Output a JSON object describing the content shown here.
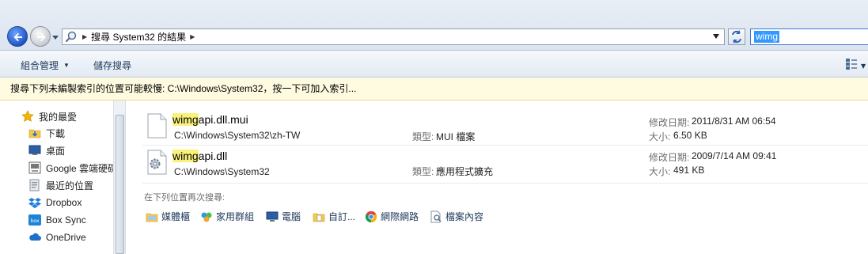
{
  "address_bar": {
    "breadcrumb": "搜尋 System32 的結果",
    "search_value": "wimg"
  },
  "toolbar": {
    "organize_label": "組合管理",
    "save_search_label": "儲存搜尋"
  },
  "info_bar": {
    "message": "搜尋下列未編製索引的位置可能較慢: C:\\Windows\\System32，按一下可加入索引..."
  },
  "nav_pane": {
    "favorites_label": "我的最愛",
    "items": [
      {
        "label": "下載",
        "icon": "download-folder-icon"
      },
      {
        "label": "桌面",
        "icon": "desktop-icon"
      },
      {
        "label": "Google 雲端硬碟",
        "icon": "google-drive-icon"
      },
      {
        "label": "最近的位置",
        "icon": "recent-places-icon"
      },
      {
        "label": "Dropbox",
        "icon": "dropbox-icon"
      },
      {
        "label": "Box Sync",
        "icon": "box-sync-icon"
      },
      {
        "label": "OneDrive",
        "icon": "onedrive-icon"
      }
    ]
  },
  "results": [
    {
      "name_highlight": "wimg",
      "name_rest": "api.dll.mui",
      "path": "C:\\Windows\\System32\\zh-TW",
      "type_label": "類型:",
      "type_value": "MUI 檔案",
      "date_label": "修改日期:",
      "date_value": "2011/8/31 AM 06:54",
      "size_label": "大小:",
      "size_value": "6.50 KB",
      "icon": "file-icon"
    },
    {
      "name_highlight": "wimg",
      "name_rest": "api.dll",
      "path": "C:\\Windows\\System32",
      "type_label": "類型:",
      "type_value": "應用程式擴充",
      "date_label": "修改日期:",
      "date_value": "2009/7/14 AM 09:41",
      "size_label": "大小:",
      "size_value": "491 KB",
      "icon": "dll-gear-icon"
    }
  ],
  "search_again": {
    "title": "在下列位置再次搜尋:",
    "locations": [
      {
        "label": "媒體櫃",
        "icon": "libraries-icon"
      },
      {
        "label": "家用群組",
        "icon": "homegroup-icon"
      },
      {
        "label": "電腦",
        "icon": "computer-icon"
      },
      {
        "label": "自訂...",
        "icon": "custom-folder-icon"
      },
      {
        "label": "網際網路",
        "icon": "internet-icon"
      },
      {
        "label": "檔案內容",
        "icon": "file-contents-icon"
      }
    ]
  }
}
